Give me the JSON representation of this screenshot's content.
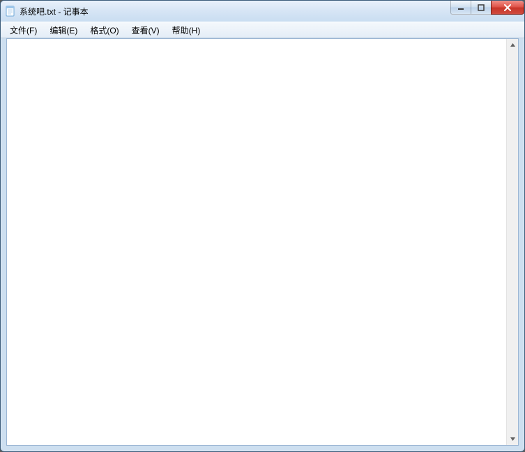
{
  "titlebar": {
    "title": "系统吧.txt - 记事本"
  },
  "menu": {
    "file": "文件(F)",
    "edit": "编辑(E)",
    "format": "格式(O)",
    "view": "查看(V)",
    "help": "帮助(H)"
  },
  "editor": {
    "content": ""
  }
}
